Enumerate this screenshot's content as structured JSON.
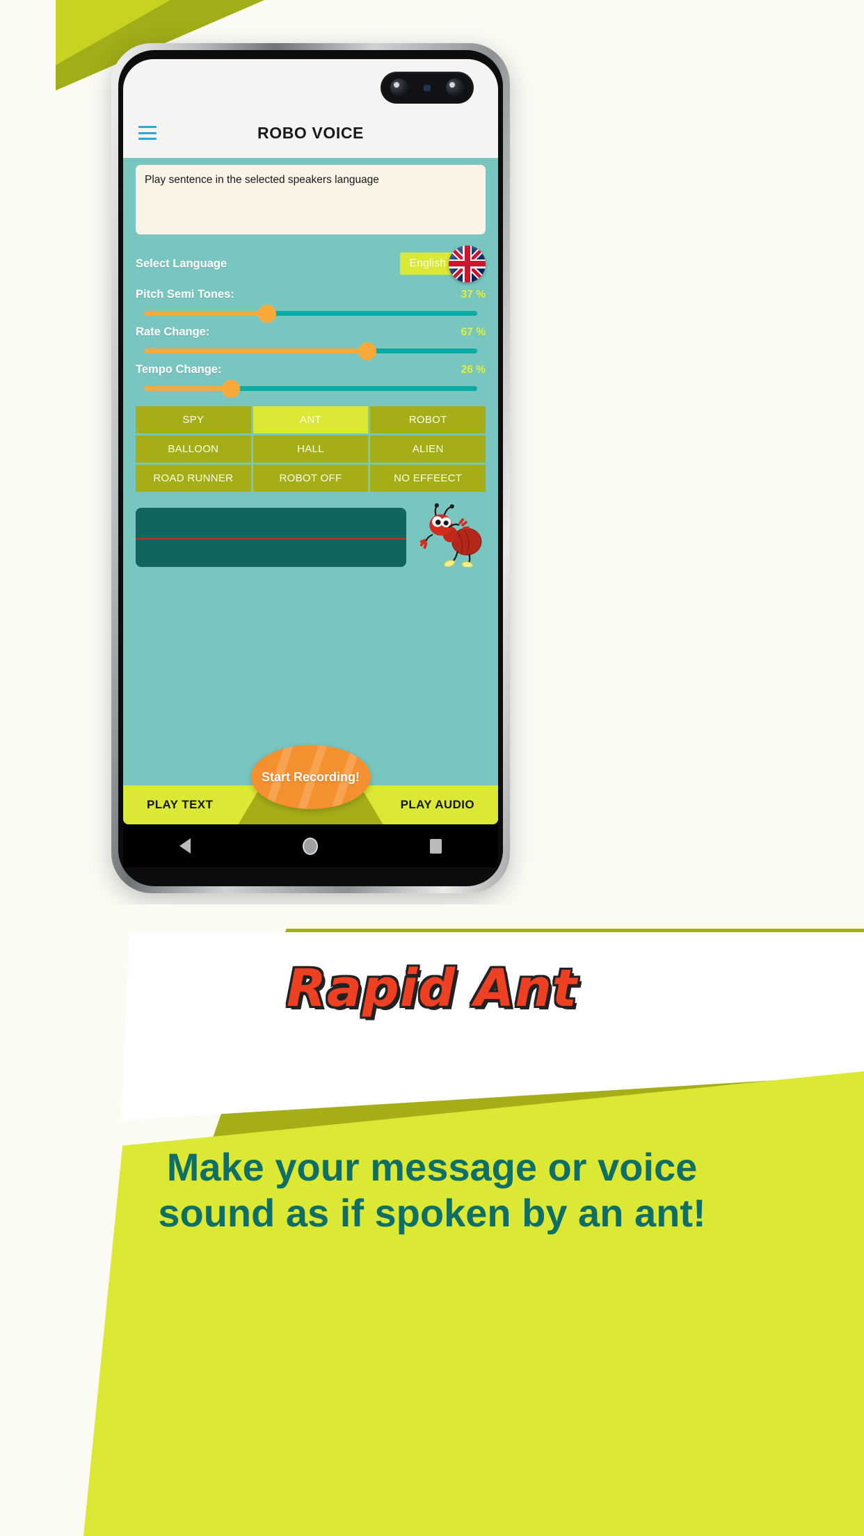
{
  "app": {
    "title": "ROBO VOICE",
    "menu_icon": "hamburger-menu-icon"
  },
  "text_area": {
    "value": "Play sentence in the selected speakers language"
  },
  "language": {
    "label": "Select Language",
    "selected": "English",
    "flag": "uk-flag-icon"
  },
  "sliders": [
    {
      "label": "Pitch Semi Tones:",
      "value": 37,
      "display": "37 %"
    },
    {
      "label": "Rate Change:",
      "value": 67,
      "display": "67 %"
    },
    {
      "label": "Tempo Change:",
      "value": 26,
      "display": "26 %"
    }
  ],
  "effects": [
    {
      "label": "SPY",
      "selected": false
    },
    {
      "label": "ANT",
      "selected": true
    },
    {
      "label": "ROBOT",
      "selected": false
    },
    {
      "label": "BALLOON",
      "selected": false
    },
    {
      "label": "HALL",
      "selected": false
    },
    {
      "label": "ALIEN",
      "selected": false
    },
    {
      "label": "ROAD RUNNER",
      "selected": false
    },
    {
      "label": "ROBOT OFF",
      "selected": false
    },
    {
      "label": "NO EFFEECT",
      "selected": false
    }
  ],
  "waveform": {
    "mascot": "red-ant-mascot-icon"
  },
  "bottom_bar": {
    "play_text": "PLAY TEXT",
    "record": "Start Recording!",
    "play_audio": "PLAY AUDIO"
  },
  "android_nav": {
    "back": "back-triangle-icon",
    "home": "home-circle-icon",
    "recents": "recents-square-icon"
  },
  "promo": {
    "title": "Rapid Ant",
    "line1": "Make your message or voice",
    "line2": "sound as if spoken by an ant!"
  },
  "colors": {
    "teal_bg": "#79c6c0",
    "dark_teal": "#11655f",
    "olive": "#a5ae16",
    "lime": "#dbe834",
    "orange": "#f9a93a",
    "record_orange": "#f4902f",
    "red": "#ee4022",
    "track_teal": "#0caaa4",
    "accent_blue": "#29a7d6"
  }
}
